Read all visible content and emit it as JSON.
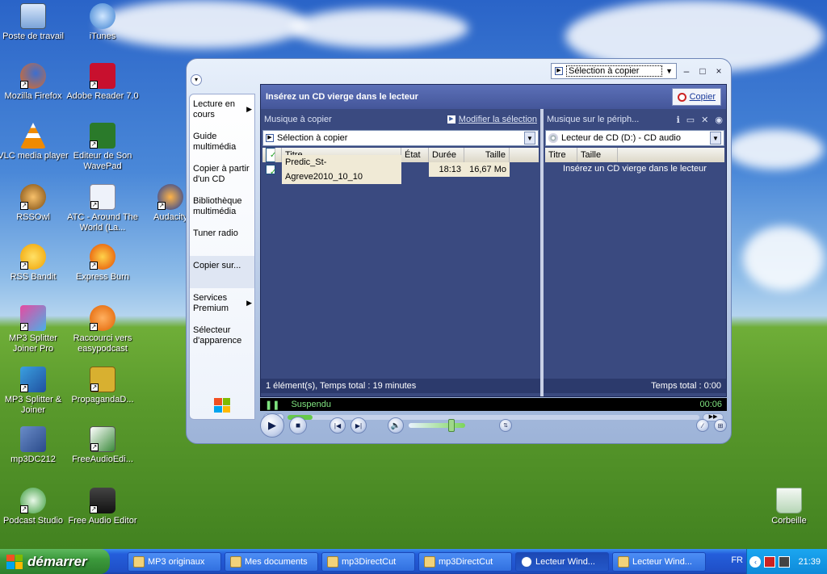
{
  "desktop": {
    "icons": [
      {
        "label": "Poste de travail",
        "icon": "computer-icon"
      },
      {
        "label": "iTunes",
        "icon": "itunes-icon"
      },
      {
        "label": "Mozilla Firefox",
        "icon": "firefox-icon"
      },
      {
        "label": "Adobe Reader 7.0",
        "icon": "adobe-reader-icon"
      },
      {
        "label": "VLC media player",
        "icon": "vlc-icon"
      },
      {
        "label": "Editeur de Son WavePad",
        "icon": "wavepad-icon"
      },
      {
        "label": "RSSOwl",
        "icon": "rssowl-icon"
      },
      {
        "label": "ATC - Around The World (La...",
        "icon": "mp3-file-icon"
      },
      {
        "label": "Audacity",
        "icon": "audacity-icon"
      },
      {
        "label": "RSS Bandit",
        "icon": "rss-bandit-icon"
      },
      {
        "label": "Express Burn",
        "icon": "express-burn-icon"
      },
      {
        "label": "MP3 Splitter Joiner Pro",
        "icon": "mp3-splitter-icon"
      },
      {
        "label": "Raccourci vers easypodcast",
        "icon": "easypodcast-icon"
      },
      {
        "label": "MP3 Splitter & Joiner",
        "icon": "mp3-splitter-joiner-icon"
      },
      {
        "label": "PropagandaD...",
        "icon": "propaganda-icon"
      },
      {
        "label": "mp3DC212",
        "icon": "package-icon"
      },
      {
        "label": "FreeAudioEdi...",
        "icon": "free-audio-editor-setup-icon"
      },
      {
        "label": "Podcast Studio",
        "icon": "podcast-studio-icon"
      },
      {
        "label": "Free Audio Editor",
        "icon": "free-audio-editor-icon"
      },
      {
        "label": "Corbeille",
        "icon": "recycle-bin-icon"
      }
    ]
  },
  "wmp": {
    "title_selector": "Sélection à copier",
    "nav": [
      {
        "label": "Lecture en cours",
        "arrow": true
      },
      {
        "label": "Guide multimédia",
        "arrow": false
      },
      {
        "label": "Copier à partir d'un CD",
        "arrow": false
      },
      {
        "label": "Bibliothèque multimédia",
        "arrow": false
      },
      {
        "label": "Tuner radio",
        "arrow": false
      },
      {
        "label": "Copier sur...",
        "arrow": false
      },
      {
        "label": "Services Premium",
        "arrow": true
      },
      {
        "label": "Sélecteur d'apparence",
        "arrow": false
      }
    ],
    "header": {
      "title": "Insérez un CD vierge dans le lecteur",
      "copy_button": "Copier"
    },
    "left": {
      "header": "Musique à copier",
      "modify_link": "Modifier la sélection",
      "combo": "Sélection à copier",
      "columns": {
        "title": "Titre",
        "state": "État",
        "duration": "Durée",
        "size": "Taille"
      },
      "rows": [
        {
          "title": "Predic_St-Agreve2010_10_10",
          "state": "",
          "duration": "18:13",
          "size": "16,67 Mo"
        }
      ],
      "footer": "1 élément(s), Temps total : 19 minutes"
    },
    "right": {
      "header": "Musique sur le périph...",
      "combo": "Lecteur de CD (D:) - CD audio",
      "columns": {
        "title": "Titre",
        "size": "Taille"
      },
      "message": "Insérez un CD vierge dans le lecteur",
      "footer": "Temps total : 0:00"
    },
    "status": {
      "text": "Suspendu",
      "time": "00:06"
    },
    "seek_progress": 0.06,
    "volume_level": 0.75
  },
  "taskbar": {
    "start_label": "démarrer",
    "tasks": [
      {
        "label": "MP3 originaux",
        "active": false
      },
      {
        "label": "Mes documents",
        "active": false
      },
      {
        "label": "mp3DirectCut",
        "active": false
      },
      {
        "label": "mp3DirectCut",
        "active": false
      },
      {
        "label": "Lecteur Wind...",
        "active": true
      },
      {
        "label": "Lecteur Wind...",
        "active": false
      }
    ],
    "lang": "FR",
    "clock": "21:39"
  }
}
